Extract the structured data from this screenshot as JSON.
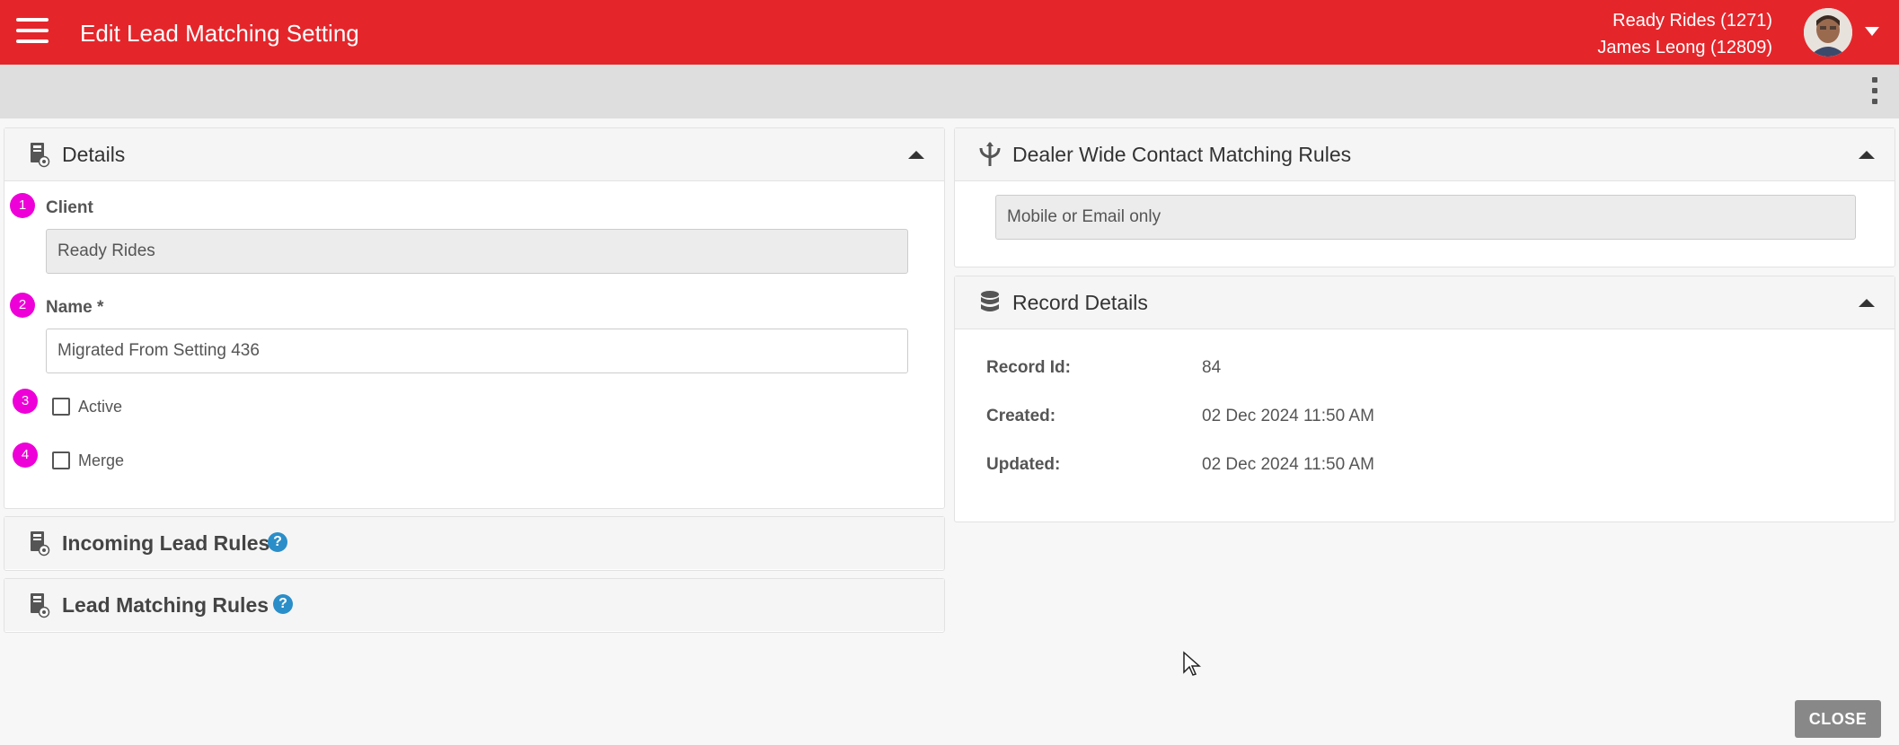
{
  "header": {
    "title": "Edit Lead Matching Setting",
    "client_line": "Ready Rides (1271)",
    "user_line": "James Leong (12809)",
    "bar_color": "#e4262b"
  },
  "details_panel": {
    "title": "Details",
    "client": {
      "badge": "1",
      "label": "Client",
      "value": "Ready Rides"
    },
    "name": {
      "badge": "2",
      "label": "Name *",
      "value": "Migrated From Setting 436"
    },
    "active": {
      "badge": "3",
      "label": "Active",
      "checked": false
    },
    "merge": {
      "badge": "4",
      "label": "Merge",
      "checked": false
    }
  },
  "incoming_lead_rules": {
    "title": "Incoming Lead Rules",
    "help": "?"
  },
  "lead_matching_rules": {
    "title": "Lead Matching Rules",
    "help": "?"
  },
  "dealer_wide_panel": {
    "title": "Dealer Wide Contact Matching Rules",
    "value": "Mobile or Email only"
  },
  "record_details": {
    "title": "Record Details",
    "rows": [
      {
        "label": "Record Id:",
        "value": "84"
      },
      {
        "label": "Created:",
        "value": "02 Dec 2024 11:50 AM"
      },
      {
        "label": "Updated:",
        "value": "02 Dec 2024 11:50 AM"
      }
    ]
  },
  "footer": {
    "close_label": "CLOSE"
  },
  "icons": {
    "menu": "hamburger-menu-icon",
    "avatar": "user-avatar",
    "more": "kebab-menu-icon",
    "document": "document-settings-icon",
    "merge": "merge-arrows-icon",
    "database": "database-icon",
    "help": "help-icon",
    "collapse": "chevron-up-icon"
  },
  "colors": {
    "badge": "#ee00d8",
    "help": "#2a8ec9",
    "close_button": "#888888"
  }
}
